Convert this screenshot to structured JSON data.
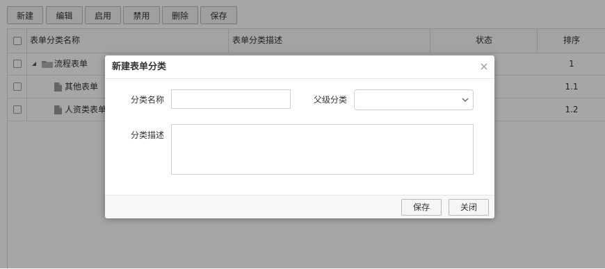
{
  "toolbar": {
    "new_label": "新建",
    "edit_label": "编辑",
    "enable_label": "启用",
    "disable_label": "禁用",
    "delete_label": "删除",
    "save_label": "保存"
  },
  "grid": {
    "columns": [
      "表单分类名称",
      "表单分类描述",
      "状态",
      "排序"
    ],
    "rows": [
      {
        "name": "流程表单",
        "order": "1",
        "icon": "folder-icon",
        "expanded": true
      },
      {
        "name": "其他表单",
        "order": "1.1",
        "icon": "file-icon"
      },
      {
        "name": "人资类表单",
        "order": "1.2",
        "icon": "file-icon"
      }
    ]
  },
  "dialog": {
    "title": "新建表单分类",
    "name_label": "分类名称",
    "name_value": "",
    "parent_label": "父级分类",
    "parent_value": "",
    "desc_label": "分类描述",
    "desc_value": "",
    "save_label": "保存",
    "close_label": "关闭"
  },
  "colors": {
    "overlay": "rgba(0,0,0,0.35)",
    "button_border": "#b9b9b9",
    "grid_line": "#dcdcdc"
  }
}
